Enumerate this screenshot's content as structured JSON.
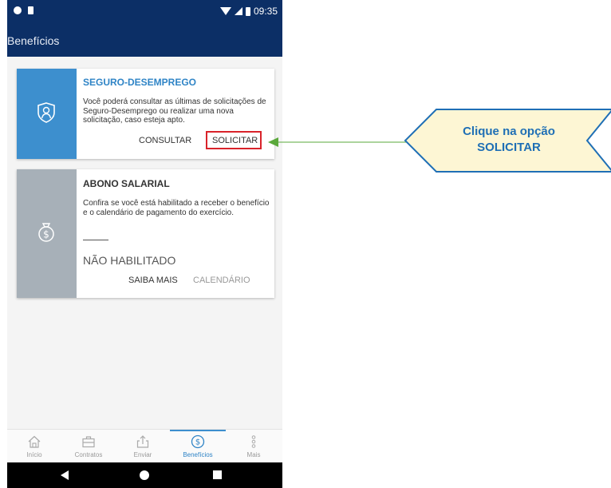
{
  "status_bar": {
    "time": "09:35"
  },
  "app_bar": {
    "title": "Benefícios"
  },
  "cards": [
    {
      "title": "SEGURO-DESEMPREGO",
      "description": "Você poderá consultar as últimas de solicitações de Seguro-Desemprego ou realizar uma nova solicitação, caso esteja apto.",
      "actions": {
        "consultar": "CONSULTAR",
        "solicitar": "SOLICITAR"
      },
      "icon": "shield-person-icon",
      "side_color": "#3d8fce"
    },
    {
      "title": "ABONO SALARIAL",
      "description": "Confira se você está habilitado a receber o benefício e o calendário de pagamento do exercício.",
      "status": "NÃO HABILITADO",
      "actions": {
        "saiba_mais": "SAIBA MAIS",
        "calendario": "CALENDÁRIO"
      },
      "icon": "money-bag-icon",
      "side_color": "#a7b0b8"
    }
  ],
  "bottom_nav": {
    "items": [
      {
        "label": "Início",
        "icon": "home-icon"
      },
      {
        "label": "Contratos",
        "icon": "briefcase-icon"
      },
      {
        "label": "Enviar",
        "icon": "upload-icon"
      },
      {
        "label": "Benefícios",
        "icon": "dollar-circle-icon",
        "active": true
      },
      {
        "label": "Mais",
        "icon": "more-vertical-icon"
      }
    ]
  },
  "callout": {
    "text": "Clique na opção SOLICITAR",
    "fill": "#fdf6d4",
    "border": "#1f6fb5",
    "arrow": "#5aa83b"
  },
  "colors": {
    "header": "#0c2f66",
    "accent": "#2f84c6",
    "highlight": "#d9232a"
  }
}
